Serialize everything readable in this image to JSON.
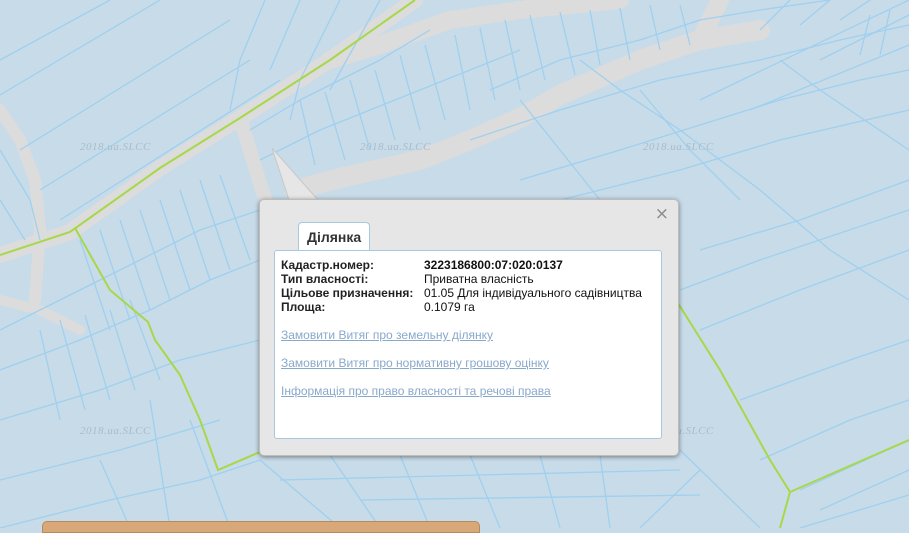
{
  "map": {
    "watermark_text": "2018.ua.SLCC",
    "colors": {
      "parcel_fill": "#c8dbe8",
      "parcel_line": "#9fd0ef",
      "road_fill": "#dcdcdc",
      "boundary_line": "#a6d84a"
    }
  },
  "popup": {
    "tab_label": "Ділянка",
    "close_icon": "×",
    "fields": [
      {
        "label": "Кадастр.номер:",
        "value": "3223186800:07:020:0137"
      },
      {
        "label": "Тип власності:",
        "value": "Приватна власність"
      },
      {
        "label": "Цільове призначення:",
        "value": "01.05 Для індивідуального садівництва"
      },
      {
        "label": "Площа:",
        "value": "0.1079 га"
      }
    ],
    "links": [
      "Замовити Витяг про земельну ділянку",
      "Замовити Витяг про нормативну грошову оцінку",
      "Інформація про право власності та речові права"
    ]
  }
}
